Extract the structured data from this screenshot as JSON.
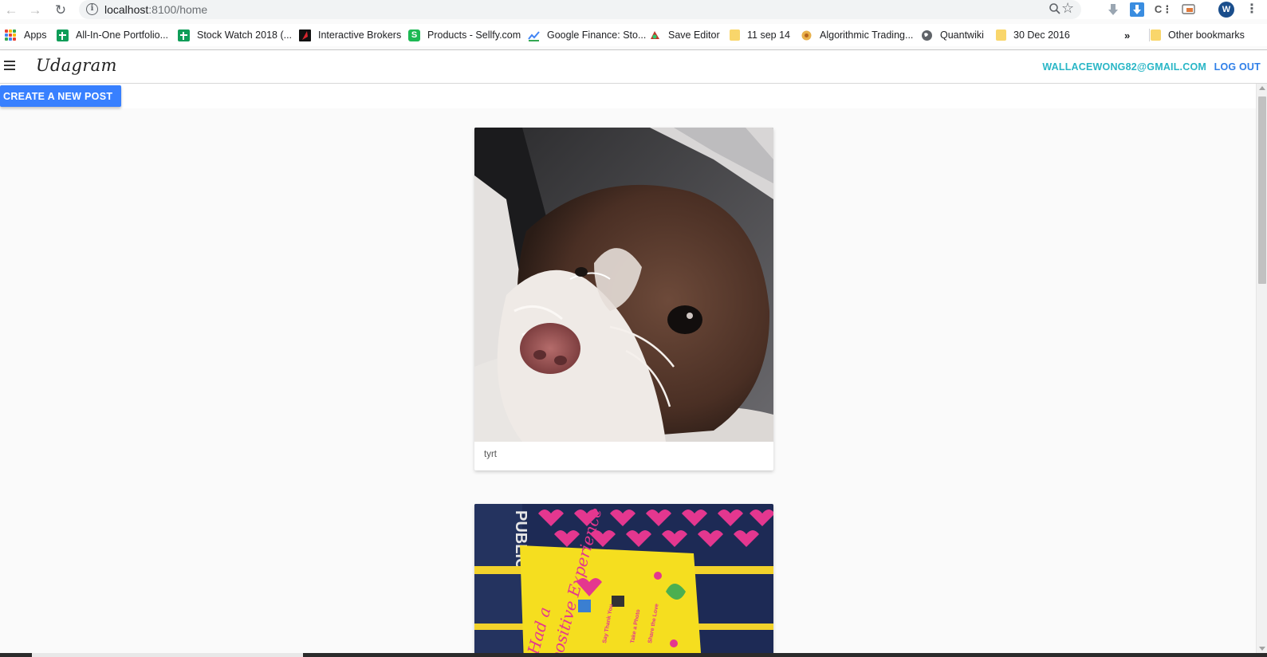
{
  "browser": {
    "url_host": "localhost",
    "url_path": ":8100/home",
    "profile_initial": "W",
    "icons": [
      "back-arrow-icon",
      "forward-arrow-icon",
      "reload-icon",
      "info-icon",
      "zoom-icon",
      "star-icon",
      "extension-icons",
      "kebab-menu-icon"
    ]
  },
  "bookmarks": {
    "items": [
      {
        "label": "Apps"
      },
      {
        "label": "All-In-One Portfolio..."
      },
      {
        "label": "Stock Watch 2018 (..."
      },
      {
        "label": "Interactive Brokers"
      },
      {
        "label": "Products - Sellfy.com"
      },
      {
        "label": "Google Finance: Sto..."
      },
      {
        "label": "Save Editor"
      },
      {
        "label": "11 sep 14"
      },
      {
        "label": "Algorithmic Trading..."
      },
      {
        "label": "Quantwiki"
      },
      {
        "label": "30 Dec 2016"
      }
    ],
    "overflow": "»",
    "other": "Other bookmarks"
  },
  "app": {
    "title": "Udagram",
    "user_email": "WALLACEWONG82@GMAIL.COM",
    "logout_label": "LOG OUT",
    "create_post_label": "CREATE A NEW POST",
    "accent_color": "#3880ff",
    "email_color": "#29b6c6"
  },
  "feed": {
    "posts": [
      {
        "caption": "tyrt",
        "image": "dog-photo"
      },
      {
        "caption": "",
        "image": "poster-photo"
      }
    ]
  }
}
